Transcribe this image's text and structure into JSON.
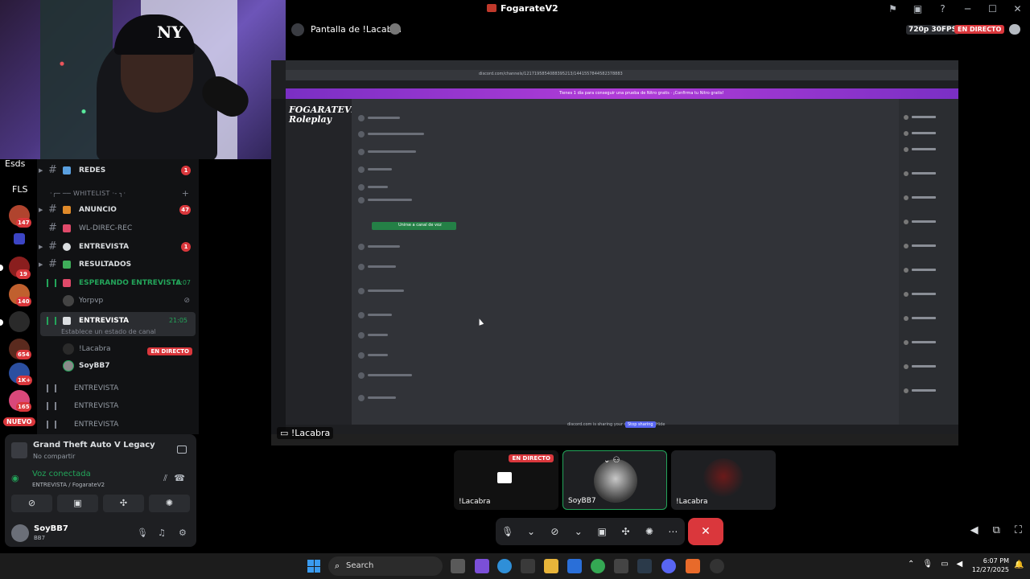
{
  "titlebar": {
    "title": "FogarateV2"
  },
  "rail": {
    "label_top": "Esds",
    "label_fls": "FLS",
    "badges": [
      "147",
      "19",
      "140",
      "654",
      "1K+",
      "165"
    ],
    "nuevo": "NUEVO"
  },
  "channels": {
    "redes": {
      "name": "REDES",
      "count": "1"
    },
    "category": "·╭─ ── WHITELIST ·- ╮·",
    "anuncio": {
      "name": "ANUNCIO",
      "count": "47"
    },
    "wl": {
      "name": "WL-DIREC-REC"
    },
    "entrevista": {
      "name": "ENTREVISTA",
      "count": "1"
    },
    "resultados": {
      "name": "RESULTADOS"
    },
    "esperando": {
      "name": "ESPERANDO ENTREVISTA",
      "time": "6:07"
    },
    "esperando_user": "Yorpvp",
    "voice_active": {
      "name": "ENTREVISTA",
      "time": "21:05",
      "status": "Establece un estado de canal"
    },
    "voice_users": [
      {
        "name": "!Lacabra",
        "live": "EN DIRECTO"
      },
      {
        "name": "SoyBB7"
      }
    ],
    "more_voice": [
      "ENTREVISTA",
      "ENTREVISTA",
      "ENTREVISTA"
    ],
    "prefix": "I"
  },
  "panel": {
    "game": {
      "name": "Grand Theft Auto V Legacy",
      "sub": "No compartir"
    },
    "voice": {
      "title": "Voz conectada",
      "sub": "ENTREVISTA / FogarateV2"
    },
    "user": {
      "name": "SoyBB7",
      "sub": "BB7"
    }
  },
  "stream": {
    "title": "Pantalla de !Lacabra",
    "quality": "720p 30FPS",
    "live": "EN DIRECTO",
    "presenter": "!Lacabra"
  },
  "shared_screen": {
    "url": "discord.com/channels/1217195854088395213/1441557844582378883",
    "banner": "Tienes 1 día para conseguir una prueba de Nitro gratis · ¡Confirma tu Nitro gratis!",
    "logo": "FOGARATEV2 Roleplay",
    "join_button": "Unirse a canal de voz",
    "sharing": "discord.com is sharing your screen.",
    "stop": "Stop sharing",
    "hide": "Hide"
  },
  "tiles": [
    {
      "name": "!Lacabra",
      "live": "EN DIRECTO"
    },
    {
      "name": "SoyBB7"
    },
    {
      "name": "!Lacabra"
    }
  ],
  "taskbar": {
    "search": "Search",
    "time": "6:07 PM",
    "date": "12/27/2025"
  },
  "icons": {
    "accent": "#5865f2",
    "danger": "#da373c",
    "online": "#23a55a"
  }
}
